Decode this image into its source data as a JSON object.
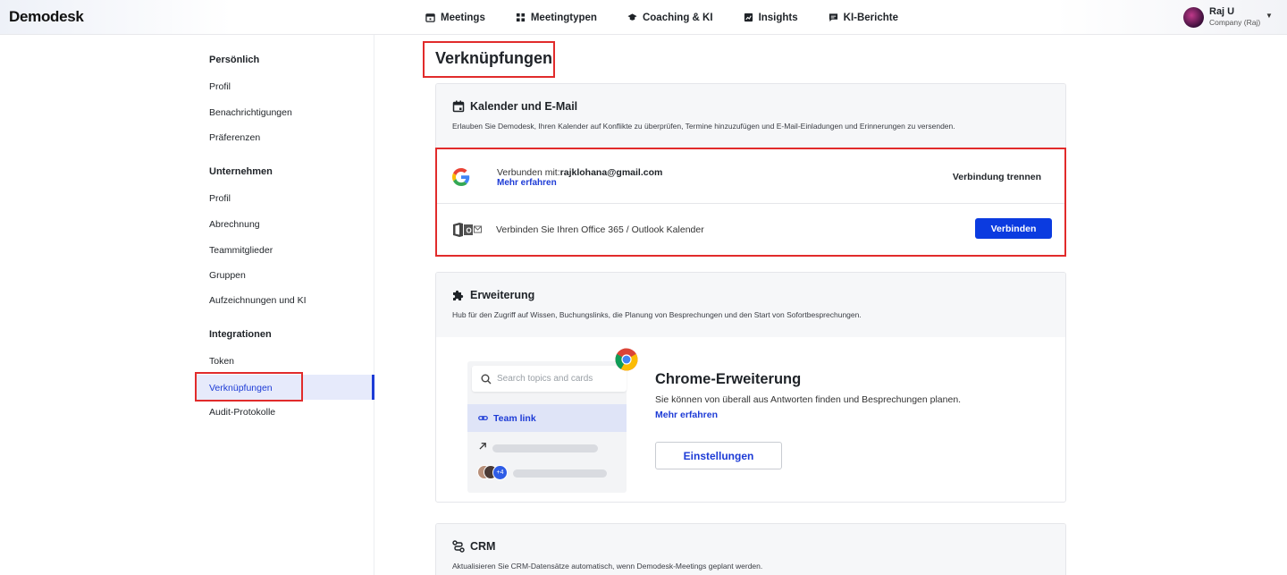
{
  "app": {
    "logo": "Demodesk"
  },
  "nav": [
    {
      "label": "Meetings",
      "icon": "calendar-icon"
    },
    {
      "label": "Meetingtypen",
      "icon": "grid-icon"
    },
    {
      "label": "Coaching & KI",
      "icon": "graduation-cap-icon"
    },
    {
      "label": "Insights",
      "icon": "chart-icon"
    },
    {
      "label": "KI-Berichte",
      "icon": "message-icon"
    }
  ],
  "user": {
    "name": "Raj U",
    "company": "Company (Raj)"
  },
  "sidebar": {
    "sections": [
      {
        "title": "Persönlich",
        "items": [
          "Profil",
          "Benachrichtigungen",
          "Präferenzen"
        ]
      },
      {
        "title": "Unternehmen",
        "items": [
          "Profil",
          "Abrechnung",
          "Teammitglieder",
          "Gruppen",
          "Aufzeichnungen und KI"
        ]
      },
      {
        "title": "Integrationen",
        "items": [
          "Token",
          "Verknüpfungen",
          "Audit-Protokolle"
        ]
      }
    ],
    "active": "Verknüpfungen"
  },
  "page": {
    "title": "Verknüpfungen"
  },
  "calendar": {
    "title": "Kalender und E-Mail",
    "description": "Erlauben Sie Demodesk, Ihren Kalender auf Konflikte zu überprüfen, Termine hinzuzufügen und E-Mail-Einladungen und Erinnerungen zu versenden.",
    "google": {
      "connected_prefix": "Verbunden mit:",
      "email": "rajklohana@gmail.com",
      "learn_more": "Mehr erfahren",
      "disconnect": "Verbindung trennen"
    },
    "outlook": {
      "text": "Verbinden Sie Ihren Office 365 / Outlook Kalender",
      "connect": "Verbinden"
    }
  },
  "extension": {
    "title": "Erweiterung",
    "description": "Hub für den Zugriff auf Wissen, Buchungslinks, die Planung von Besprechungen und den Start von Sofortbesprechungen.",
    "preview": {
      "search_placeholder": "Search topics and cards",
      "team_link": "Team link",
      "avatar_count": "+4"
    },
    "chrome_title": "Chrome-Erweiterung",
    "chrome_desc": "Sie können von überall aus Antworten finden und Besprechungen planen.",
    "learn_more": "Mehr erfahren",
    "settings": "Einstellungen"
  },
  "crm": {
    "title": "CRM",
    "description": "Aktualisieren Sie CRM-Datensätze automatisch, wenn Demodesk-Meetings geplant werden."
  }
}
